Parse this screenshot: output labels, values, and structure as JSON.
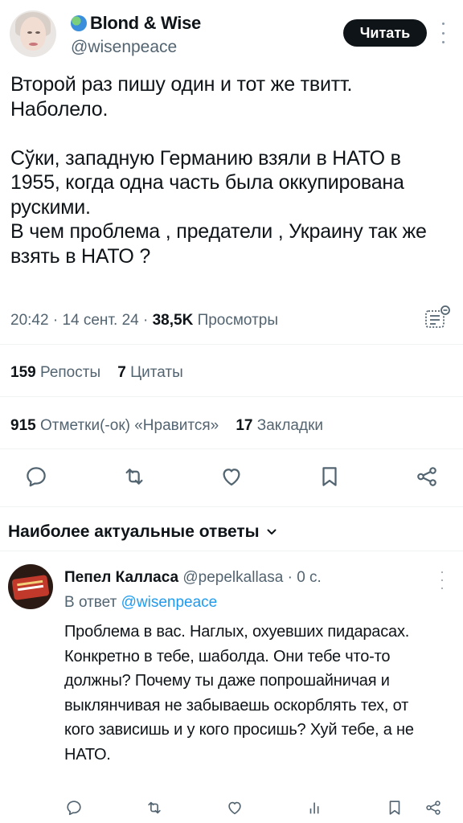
{
  "tweet": {
    "author_name": "Blond & Wise",
    "author_handle": "@wisenpeace",
    "follow_label": "Читать",
    "text": "Второй раз пишу один и тот же твитт.\nНаболело.\n\nСўки, западную Германию взяли в НАТО в 1955, когда одна часть была оккупирована рускими.\nВ чем проблема , предатели , Украину так же взять в НАТО ?",
    "time": "20:42",
    "date": "14 сент. 24",
    "views_count": "38,5K",
    "views_label": "Просмотры",
    "reposts_count": "159",
    "reposts_label": "Репосты",
    "quotes_count": "7",
    "quotes_label": "Цитаты",
    "likes_count": "915",
    "likes_label": "Отметки(-ок) «Нравится»",
    "bookmarks_count": "17",
    "bookmarks_label": "Закладки",
    "sep": "·"
  },
  "replies_sort": {
    "label": "Наиболее актуальные ответы"
  },
  "reply": {
    "author_name": "Пепел Калласа",
    "author_handle": "@pepelkallasa",
    "sep": "·",
    "time": "0 с.",
    "reply_to_prefix": "В ответ",
    "reply_to_handle": "@wisenpeace",
    "text": "Проблема в вас. Наглых, охуевших пидарасах. Конкретно в тебе, шаболда. Они тебе что-то должны? Почему ты даже попрошайничая и выклянчивая не забываешь оскорблять тех, от кого зависишь и у кого просишь? Хуй тебе, а не НАТО."
  },
  "icons": {
    "more": "more-vertical-icon",
    "analytics": "analytics-icon",
    "reply": "reply-icon",
    "repost": "repost-icon",
    "like": "heart-icon",
    "bookmark": "bookmark-icon",
    "share": "share-icon",
    "views": "views-icon",
    "chevron": "chevron-down-icon"
  },
  "colors": {
    "text": "#0f1419",
    "secondary": "#536471",
    "link": "#1d9bf0",
    "button_bg": "#0f1419",
    "button_text": "#ffffff"
  }
}
